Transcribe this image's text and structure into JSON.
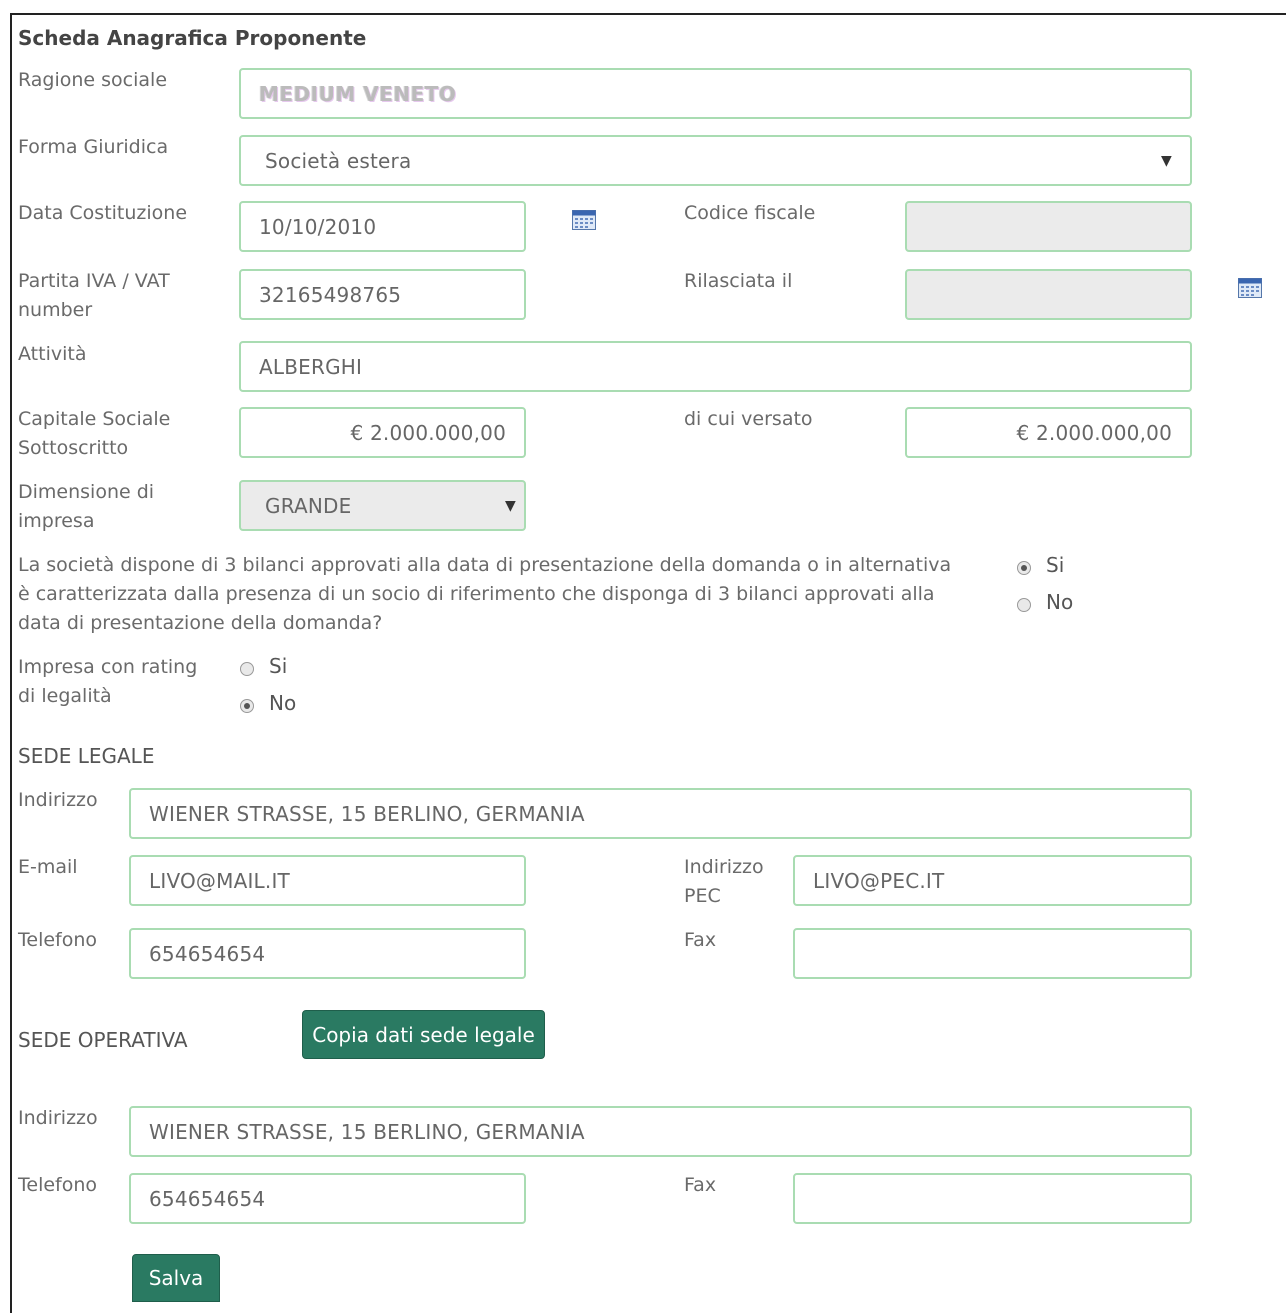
{
  "form": {
    "title": "Scheda Anagrafica Proponente",
    "ragione_sociale": {
      "label": "Ragione sociale",
      "value": "MEDIUM VENETO"
    },
    "forma_giuridica": {
      "label": "Forma Giuridica",
      "value": "Società estera"
    },
    "data_costituzione": {
      "label": "Data Costituzione",
      "value": "10/10/2010"
    },
    "codice_fiscale": {
      "label": "Codice fiscale",
      "value": ""
    },
    "partita_iva": {
      "label": "Partita IVA / VAT number",
      "value": "32165498765"
    },
    "rilasciata_il": {
      "label": "Rilasciata il",
      "value": ""
    },
    "attivita": {
      "label": "Attività",
      "value": "ALBERGHI"
    },
    "capitale_sociale": {
      "label": "Capitale Sociale Sottoscritto",
      "value": "€ 2.000.000,00"
    },
    "di_cui_versato": {
      "label": "di cui versato",
      "value": "€ 2.000.000,00"
    },
    "dimensione_impresa": {
      "label": "Dimensione di impresa",
      "value": "GRANDE"
    },
    "bilanci_question": {
      "text": "La società dispone di 3 bilanci approvati alla data di presentazione della domanda o in alternativa è caratterizzata dalla presenza di un socio di riferimento che disponga di 3 bilanci approvati alla data di presentazione della domanda?",
      "options": [
        "Si",
        "No"
      ],
      "selected": "Si"
    },
    "rating_legalita": {
      "label": "Impresa con rating di legalità",
      "options": [
        "Si",
        "No"
      ],
      "selected": "No"
    }
  },
  "sede_legale": {
    "heading": "SEDE LEGALE",
    "indirizzo": {
      "label": "Indirizzo",
      "value": "WIENER STRASSE, 15 BERLINO, GERMANIA"
    },
    "email": {
      "label": "E-mail",
      "value": "LIVO@MAIL.IT"
    },
    "pec": {
      "label": "Indirizzo PEC",
      "value": "LIVO@PEC.IT"
    },
    "telefono": {
      "label": "Telefono",
      "value": "654654654"
    },
    "fax": {
      "label": "Fax",
      "value": ""
    }
  },
  "sede_operativa": {
    "heading": "SEDE OPERATIVA",
    "copy_button": "Copia dati sede legale",
    "indirizzo": {
      "label": "Indirizzo",
      "value": "WIENER STRASSE, 15 BERLINO, GERMANIA"
    },
    "telefono": {
      "label": "Telefono",
      "value": "654654654"
    },
    "fax": {
      "label": "Fax",
      "value": ""
    }
  },
  "actions": {
    "save": "Salva"
  },
  "icons": {
    "calendar": "calendar-icon",
    "dropdown": "chevron-down-icon"
  },
  "colors": {
    "field_border": "#a9dcb2",
    "button_bg": "#2a7a62"
  }
}
